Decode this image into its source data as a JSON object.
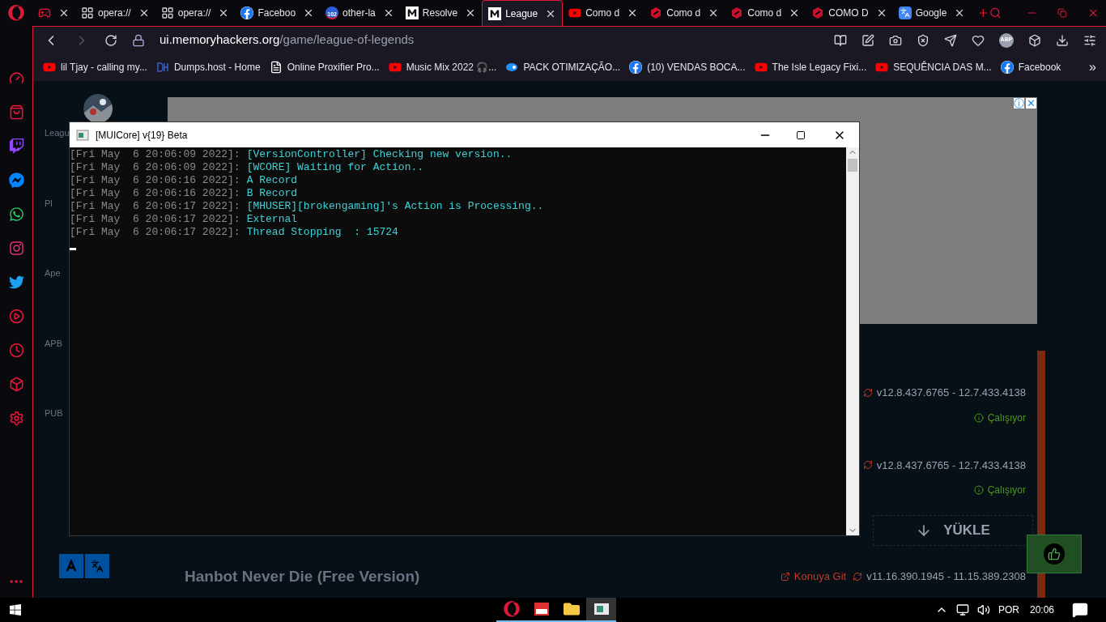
{
  "tabs": [
    {
      "kind": "gamepad",
      "selected": false
    },
    {
      "kind": "grid",
      "label": "opera://",
      "selected": false
    },
    {
      "kind": "grid",
      "label": "opera://",
      "selected": false
    },
    {
      "kind": "facebook",
      "label": "Faceboo",
      "selected": false
    },
    {
      "kind": "badge",
      "label": "other-la",
      "badge": "102",
      "selected": false
    },
    {
      "kind": "m",
      "label": "Resolve",
      "selected": false
    },
    {
      "kind": "m",
      "label": "League",
      "selected": true
    },
    {
      "kind": "youtube",
      "label": "Como d",
      "selected": false
    },
    {
      "kind": "hex",
      "label": "Como d",
      "selected": false
    },
    {
      "kind": "hex",
      "label": "Como d",
      "selected": false
    },
    {
      "kind": "hex",
      "label": "COMO D",
      "selected": false
    },
    {
      "kind": "translate",
      "label": "Google",
      "selected": false
    }
  ],
  "address": {
    "host": "ui.memoryhackers.org",
    "path": "/game/league-of-legends"
  },
  "adblock_badge": "ABP",
  "bookmarks": [
    {
      "kind": "youtube",
      "label": "lil Tjay - calling my..."
    },
    {
      "kind": "dh",
      "label": "Dumps.host - Home"
    },
    {
      "kind": "file",
      "label": "Online Proxifier Pro..."
    },
    {
      "kind": "youtube",
      "label": "Music Mix 2022 🎧..."
    },
    {
      "kind": "drop",
      "label": "PACK OTIMIZAÇÃO..."
    },
    {
      "kind": "facebook",
      "label": "(10) VENDAS BOCA..."
    },
    {
      "kind": "youtube",
      "label": "The Isle Legacy Fixi..."
    },
    {
      "kind": "youtube",
      "label": "SEQUÊNCIA DAS M..."
    },
    {
      "kind": "facebook",
      "label": "Facebook"
    }
  ],
  "bookmarks_more": "»",
  "side_nav": [
    "Leagu",
    "Pl",
    "Ape",
    "APB",
    "PUB"
  ],
  "ad_marks": [
    "ⓘ",
    "✕"
  ],
  "products": [
    {
      "version": "v12.8.437.6765 - 12.7.433.4138",
      "status": "Çalışıyor"
    },
    {
      "version": "v12.8.437.6765 - 12.7.433.4138",
      "status": "Çalışıyor"
    }
  ],
  "download_button": "YÜKLE",
  "next_product": {
    "title": "Hanbot Never Die (Free Version)",
    "link": "Konuya Git",
    "version": "v11.16.390.1945 - 11.15.389.2308"
  },
  "console": {
    "title": "[MUICore] v{19} Beta",
    "lines": [
      {
        "time": "[Fri May  6 20:06:09 2022]:",
        "message": "[VersionController] Checking new version.."
      },
      {
        "time": "[Fri May  6 20:06:09 2022]:",
        "message": "[WCORE] Waiting for Action.."
      },
      {
        "time": "[Fri May  6 20:06:16 2022]:",
        "message": "A Record"
      },
      {
        "time": "[Fri May  6 20:06:16 2022]:",
        "message": "B Record"
      },
      {
        "time": "[Fri May  6 20:06:17 2022]:",
        "message": "[MHUSER][brokengaming]'s Action is Processing.."
      },
      {
        "time": "[Fri May  6 20:06:17 2022]:",
        "message": "External"
      },
      {
        "time": "[Fri May  6 20:06:17 2022]:",
        "message": "Thread Stopping  : 15724"
      }
    ]
  },
  "taskbar": {
    "apps": [
      {
        "kind": "opera",
        "active": false
      },
      {
        "kind": "app",
        "active": false
      },
      {
        "kind": "folder",
        "active": false
      },
      {
        "kind": "console",
        "active": true
      }
    ],
    "language": "POR",
    "time": "20:06"
  }
}
